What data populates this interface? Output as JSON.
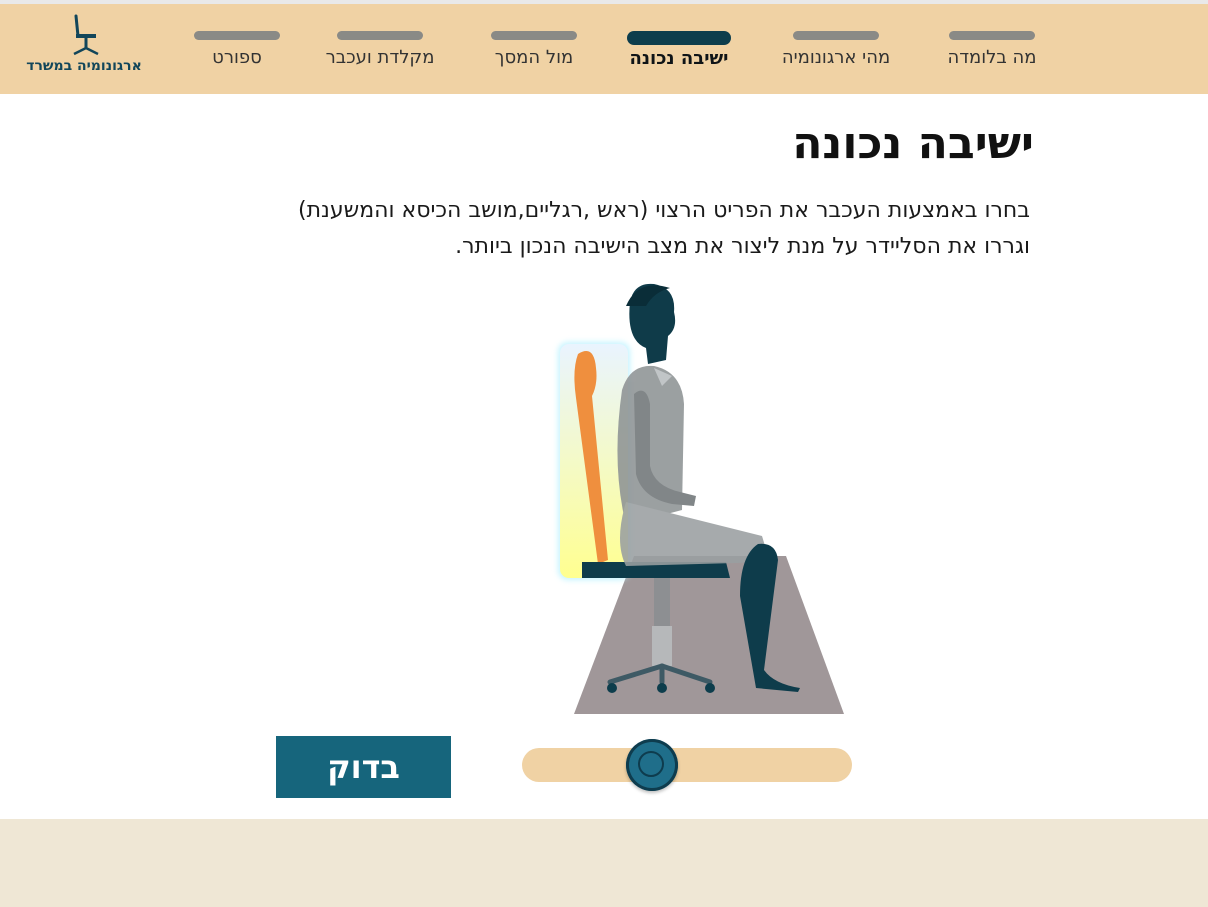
{
  "header": {
    "logo_label": "ארגונומיה במשרד",
    "logo_icon": "office-chair-icon",
    "nav": [
      {
        "label": "מה בלומדה",
        "active": false
      },
      {
        "label": "מהי ארגונומיה",
        "active": false
      },
      {
        "label": "ישיבה נכונה",
        "active": true
      },
      {
        "label": "מול המסך",
        "active": false
      },
      {
        "label": "מקלדת ועכבר",
        "active": false
      },
      {
        "label": "ספורט",
        "active": false
      }
    ]
  },
  "main": {
    "title": "ישיבה נכונה",
    "instruction_line1": "בחרו באמצעות העכבר את הפריט הרצוי (ראש ,רגליים,מושב הכיסא והמשענת)",
    "instruction_line2": "וגררו את הסליידר על מנת  ליצור את מצב הישיבה הנכון ביותר.",
    "slider_value": 0.375,
    "check_button": "בדוק"
  },
  "colors": {
    "header_bg": "#f0d2a4",
    "accent": "#16657c",
    "active_nav": "#0d3d4c",
    "footer_bg": "#efe7d5",
    "highlight": "#ffff99"
  }
}
